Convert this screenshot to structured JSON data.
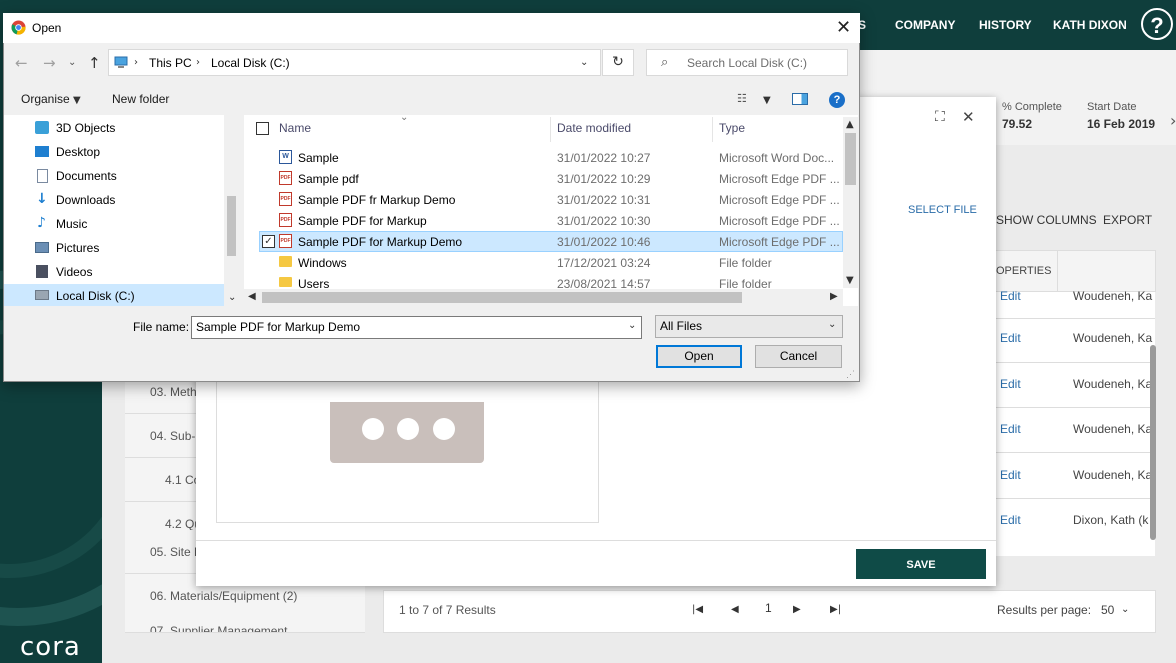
{
  "app": {
    "topnav": [
      "S",
      "COMPANY",
      "HISTORY",
      "KATH DIXON"
    ],
    "help_label": "?",
    "logo": "cora",
    "stats": [
      {
        "label": "% Complete",
        "value": "79.52"
      },
      {
        "label": "Start Date",
        "value": "16 Feb 2019"
      }
    ],
    "actions": {
      "show_columns": "SHOW COLUMNS",
      "export": "EXPORT",
      "properties": "OPERTIES"
    },
    "tree": [
      "03. Meth",
      "04. Sub-C",
      "4.1 Co",
      "4.2 Qu",
      "05. Site E",
      "06. Materials/Equipment (2)",
      "07. Supplier Management"
    ],
    "rows": [
      {
        "edit": "Edit",
        "owner": "Woudeneh, Ka"
      },
      {
        "edit": "Edit",
        "owner": "Woudeneh, Ka"
      },
      {
        "edit": "Edit",
        "owner": "Woudeneh, Ka"
      },
      {
        "edit": "Edit",
        "owner": "Woudeneh, Ka"
      },
      {
        "edit": "Edit",
        "owner": "Woudeneh, Ka"
      },
      {
        "edit": "Edit",
        "owner": "Dixon, Kath (k"
      }
    ],
    "pager": {
      "summary": "1 to 7 of 7 Results",
      "page": "1",
      "rpp_label": "Results per page:",
      "rpp_value": "50"
    }
  },
  "modal": {
    "select_file": "SELECT FILE",
    "save": "SAVE"
  },
  "dialog": {
    "title": "Open",
    "breadcrumb": [
      "This PC",
      "Local Disk (C:)"
    ],
    "search_placeholder": "Search Local Disk (C:)",
    "toolbar": {
      "organise": "Organise",
      "new_folder": "New folder"
    },
    "nav": [
      "3D Objects",
      "Desktop",
      "Documents",
      "Downloads",
      "Music",
      "Pictures",
      "Videos",
      "Local Disk (C:)"
    ],
    "columns": {
      "name": "Name",
      "date": "Date modified",
      "type": "Type"
    },
    "files": [
      {
        "name": "Sample",
        "date": "31/01/2022 10:27",
        "type": "Microsoft Word Doc...",
        "kind": "word"
      },
      {
        "name": "Sample pdf",
        "date": "31/01/2022 10:29",
        "type": "Microsoft Edge PDF ...",
        "kind": "pdf"
      },
      {
        "name": "Sample PDF fr Markup Demo",
        "date": "31/01/2022 10:31",
        "type": "Microsoft Edge PDF ...",
        "kind": "pdf"
      },
      {
        "name": "Sample PDF for Markup",
        "date": "31/01/2022 10:30",
        "type": "Microsoft Edge PDF ...",
        "kind": "pdf"
      },
      {
        "name": "Sample PDF for Markup Demo",
        "date": "31/01/2022 10:46",
        "type": "Microsoft Edge PDF ...",
        "kind": "pdf"
      },
      {
        "name": "Windows",
        "date": "17/12/2021 03:24",
        "type": "File folder",
        "kind": "folder"
      },
      {
        "name": "Users",
        "date": "23/08/2021 14:57",
        "type": "File folder",
        "kind": "folder"
      }
    ],
    "file_name_label": "File name:",
    "file_name_value": "Sample PDF for Markup Demo",
    "filter": "All Files",
    "open": "Open",
    "cancel": "Cancel",
    "pdf_badge": "PDF",
    "word_badge": "W",
    "colors": {
      "selected_row": "#cce8ff",
      "accent": "#0078d7",
      "brand": "#0f3e3c"
    }
  }
}
